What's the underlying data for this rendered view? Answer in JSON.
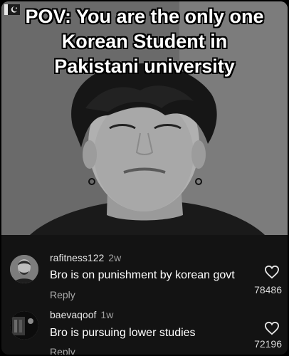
{
  "caption": {
    "line1": "POV: You are the only one",
    "line2": "Korean Student in",
    "line3": "Pakistani university"
  },
  "comments": [
    {
      "username": "rafitness122",
      "time": "2w",
      "text": "Bro is on punishment by korean govt",
      "reply": "Reply",
      "likes": "78486"
    },
    {
      "username": "baevaqoof",
      "time": "1w",
      "text": "Bro is pursuing lower studies",
      "reply": "Reply",
      "likes": "72196"
    }
  ],
  "icons": {
    "flag": "pakistan-flag-icon",
    "like": "heart-outline-icon"
  }
}
